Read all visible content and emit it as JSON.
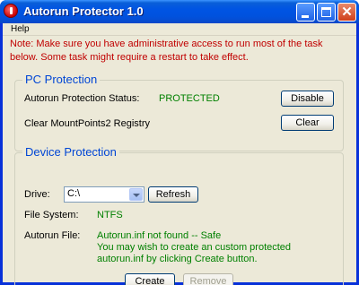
{
  "window": {
    "title": "Autorun Protector 1.0"
  },
  "menu": {
    "help": "Help"
  },
  "note": "Note: Make sure you have administrative access to run most of the task below. Some task might require a restart to take effect.",
  "pc_protection": {
    "heading": "PC Protection",
    "status_label": "Autorun Protection Status:",
    "status_value": "PROTECTED",
    "disable_button": "Disable",
    "clear_label": "Clear MountPoints2 Registry",
    "clear_button": "Clear"
  },
  "device_protection": {
    "heading": "Device Protection",
    "drive_label": "Drive:",
    "drive_value": "C:\\",
    "refresh_button": "Refresh",
    "fs_label": "File System:",
    "fs_value": "NTFS",
    "autorun_label": "Autorun File:",
    "autorun_line1": "Autorun.inf not found -- Safe",
    "autorun_line2": "You may wish to create an custom protected",
    "autorun_line3": "autorun.inf by clicking Create button.",
    "create_button": "Create",
    "remove_button": "Remove"
  },
  "colors": {
    "status_green": "#008000",
    "note_red": "#c00000",
    "heading_blue": "#0046d5"
  }
}
